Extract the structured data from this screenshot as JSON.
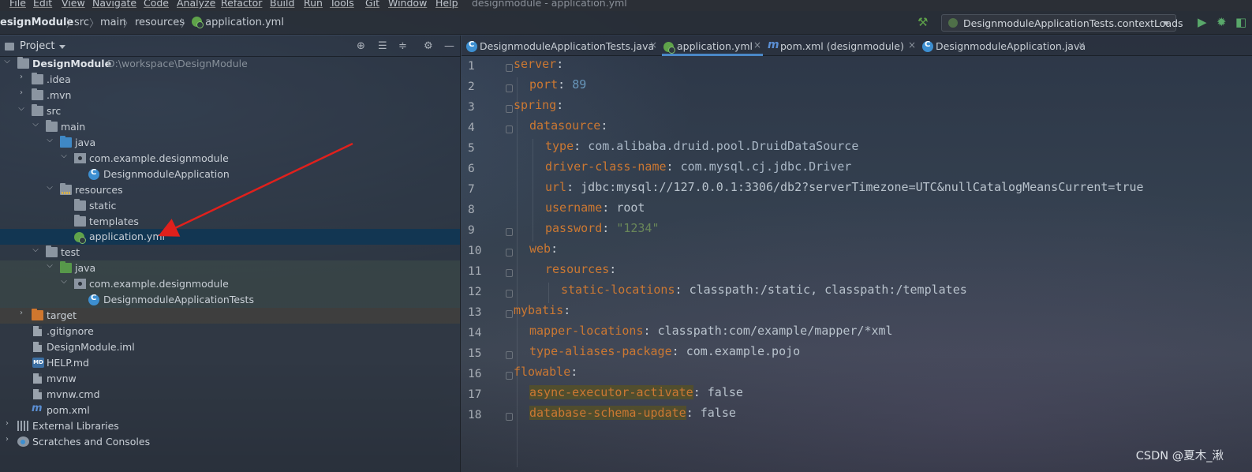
{
  "window": {
    "menu": [
      "File",
      "Edit",
      "View",
      "Navigate",
      "Code",
      "Analyze",
      "Refactor",
      "Build",
      "Run",
      "Tools",
      "Git",
      "Window",
      "Help"
    ],
    "title": "designmodule - application.yml"
  },
  "breadcrumb": [
    "esignModule",
    "src",
    "main",
    "resources",
    "application.yml"
  ],
  "run_config": {
    "label": "DesignmoduleApplicationTests.contextLoads"
  },
  "project_panel": {
    "title": "Project",
    "tree": [
      {
        "label": "DesignModule",
        "hint": "D:\\workspace\\DesignModule",
        "bold": true
      },
      {
        "label": ".idea"
      },
      {
        "label": ".mvn"
      },
      {
        "label": "src"
      },
      {
        "label": "main"
      },
      {
        "label": "java"
      },
      {
        "label": "com.example.designmodule"
      },
      {
        "label": "DesignmoduleApplication"
      },
      {
        "label": "resources"
      },
      {
        "label": "static"
      },
      {
        "label": "templates"
      },
      {
        "label": "application.yml"
      },
      {
        "label": "test"
      },
      {
        "label": "java"
      },
      {
        "label": "com.example.designmodule"
      },
      {
        "label": "DesignmoduleApplicationTests"
      },
      {
        "label": "target"
      },
      {
        "label": ".gitignore"
      },
      {
        "label": "DesignModule.iml"
      },
      {
        "label": "HELP.md"
      },
      {
        "label": "mvnw"
      },
      {
        "label": "mvnw.cmd"
      },
      {
        "label": "pom.xml"
      },
      {
        "label": "External Libraries"
      },
      {
        "label": "Scratches and Consoles"
      }
    ]
  },
  "tabs": [
    {
      "label": "DesignmoduleApplicationTests.java",
      "close": "×"
    },
    {
      "label": "application.yml",
      "close": "×"
    },
    {
      "label": "pom.xml (designmodule)",
      "close": "×"
    },
    {
      "label": "DesignmoduleApplication.java",
      "close": "×"
    }
  ],
  "editor": {
    "line_numbers": [
      "1",
      "2",
      "3",
      "4",
      "5",
      "6",
      "7",
      "8",
      "9",
      "10",
      "11",
      "12",
      "13",
      "14",
      "15",
      "16",
      "17",
      "18"
    ],
    "lines": [
      {
        "key": "server",
        "sep": ":",
        "value": ""
      },
      {
        "key": "port",
        "sep": ": ",
        "value": "89"
      },
      {
        "key": "spring",
        "sep": ":",
        "value": ""
      },
      {
        "key": "datasource",
        "sep": ":",
        "value": ""
      },
      {
        "key": "type",
        "sep": ": ",
        "value": "com.alibaba.druid.pool.DruidDataSource"
      },
      {
        "key": "driver-class-name",
        "sep": ": ",
        "value": "com.mysql.cj.jdbc.Driver"
      },
      {
        "key": "url",
        "sep": ": ",
        "value": "jdbc:mysql://127.0.0.1:3306/db2?serverTimezone=UTC&nullCatalogMeansCurrent=true"
      },
      {
        "key": "username",
        "sep": ": ",
        "value": "root"
      },
      {
        "key": "password",
        "sep": ": ",
        "value": "\"1234\""
      },
      {
        "key": "web",
        "sep": ":",
        "value": ""
      },
      {
        "key": "resources",
        "sep": ":",
        "value": ""
      },
      {
        "key": "static-locations",
        "sep": ": ",
        "value": "classpath:/static, classpath:/templates"
      },
      {
        "key": "mybatis",
        "sep": ":",
        "value": ""
      },
      {
        "key": "mapper-locations",
        "sep": ": ",
        "value": "classpath:com/example/mapper/*xml"
      },
      {
        "key": "type-aliases-package",
        "sep": ": ",
        "value": "com.example.pojo"
      },
      {
        "key": "flowable",
        "sep": ":",
        "value": ""
      },
      {
        "key": "async-executor-activate",
        "sep": ": ",
        "value": "false"
      },
      {
        "key": "database-schema-update",
        "sep": ": ",
        "value": "false"
      }
    ]
  },
  "watermark": "CSDN @夏木_湫",
  "colors": {
    "key": "#cc7832",
    "string": "#6a8759",
    "number": "#6897bb",
    "selection": "#103654",
    "annotation_arrow": "#e0201c"
  }
}
